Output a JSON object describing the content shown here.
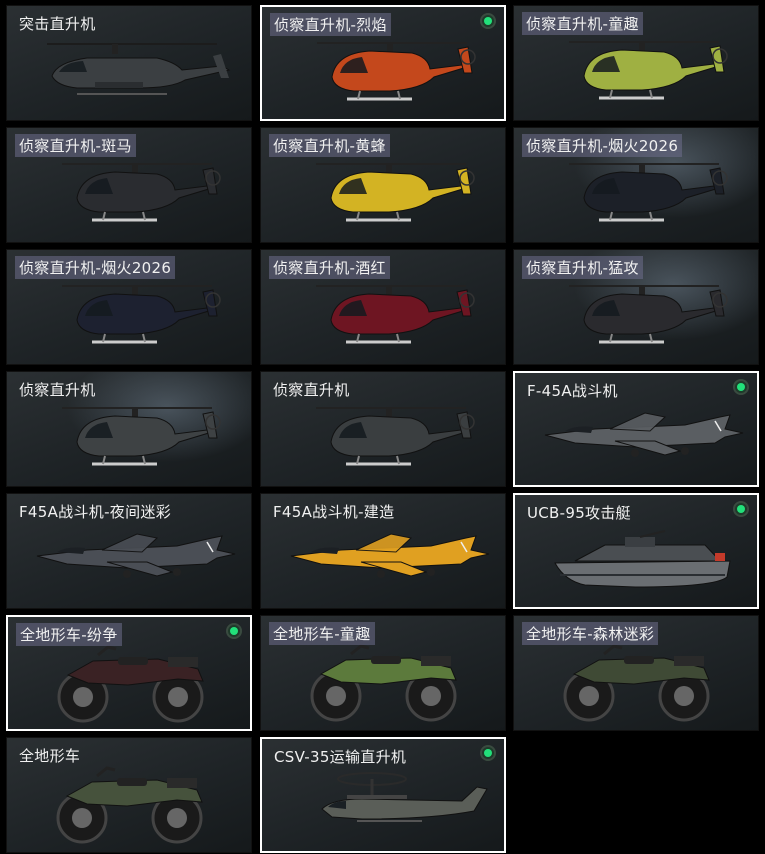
{
  "accent": "#22e07a",
  "items": [
    {
      "name": "突击直升机",
      "kind": "attack",
      "color": "#3b3f42",
      "selected": false,
      "owned": false,
      "hl": false
    },
    {
      "name": "侦察直升机-烈焰",
      "kind": "heli",
      "color": "#c4481c",
      "selected": true,
      "owned": true,
      "hl": true
    },
    {
      "name": "侦察直升机-童趣",
      "kind": "heli",
      "color": "#9fb042",
      "selected": false,
      "owned": false,
      "hl": true
    },
    {
      "name": "侦察直升机-斑马",
      "kind": "heli",
      "color": "#2a2c30",
      "selected": false,
      "owned": false,
      "hl": true
    },
    {
      "name": "侦察直升机-黄蜂",
      "kind": "heli",
      "color": "#d3b323",
      "selected": false,
      "owned": false,
      "hl": true
    },
    {
      "name": "侦察直升机-烟火2026",
      "kind": "heli",
      "color": "#1c2028",
      "selected": false,
      "owned": false,
      "hl": true
    },
    {
      "name": "侦察直升机-烟火2026",
      "kind": "heli",
      "color": "#1d2130",
      "selected": false,
      "owned": false,
      "hl": true
    },
    {
      "name": "侦察直升机-酒红",
      "kind": "heli",
      "color": "#6e1522",
      "selected": false,
      "owned": false,
      "hl": true
    },
    {
      "name": "侦察直升机-猛攻",
      "kind": "heli",
      "color": "#2a2a2e",
      "selected": false,
      "owned": false,
      "hl": true
    },
    {
      "name": "侦察直升机",
      "kind": "heli",
      "color": "#3e4244",
      "selected": false,
      "owned": false,
      "hl": false
    },
    {
      "name": "侦察直升机",
      "kind": "heli",
      "color": "#3a3e40",
      "selected": false,
      "owned": false,
      "hl": false
    },
    {
      "name": "F-45A战斗机",
      "kind": "jet",
      "color": "#5a5e62",
      "selected": true,
      "owned": true,
      "hl": false
    },
    {
      "name": "F45A战斗机-夜间迷彩",
      "kind": "jet",
      "color": "#4a4e55",
      "selected": false,
      "owned": false,
      "hl": false
    },
    {
      "name": "F45A战斗机-建造",
      "kind": "jet",
      "color": "#e0a021",
      "selected": false,
      "owned": false,
      "hl": false
    },
    {
      "name": "UCB-95攻击艇",
      "kind": "boat",
      "color": "#6a6e72",
      "selected": true,
      "owned": true,
      "hl": false
    },
    {
      "name": "全地形车-纷争",
      "kind": "atv",
      "color": "#3a2224",
      "selected": true,
      "owned": true,
      "hl": true
    },
    {
      "name": "全地形车-童趣",
      "kind": "atv",
      "color": "#5c7a3c",
      "selected": false,
      "owned": false,
      "hl": true
    },
    {
      "name": "全地形车-森林迷彩",
      "kind": "atv",
      "color": "#3f4a35",
      "selected": false,
      "owned": false,
      "hl": true
    },
    {
      "name": "全地形车",
      "kind": "atv",
      "color": "#46523c",
      "selected": false,
      "owned": false,
      "hl": false
    },
    {
      "name": "CSV-35运输直升机",
      "kind": "osprey",
      "color": "#5a5e58",
      "selected": true,
      "owned": true,
      "hl": false
    }
  ]
}
